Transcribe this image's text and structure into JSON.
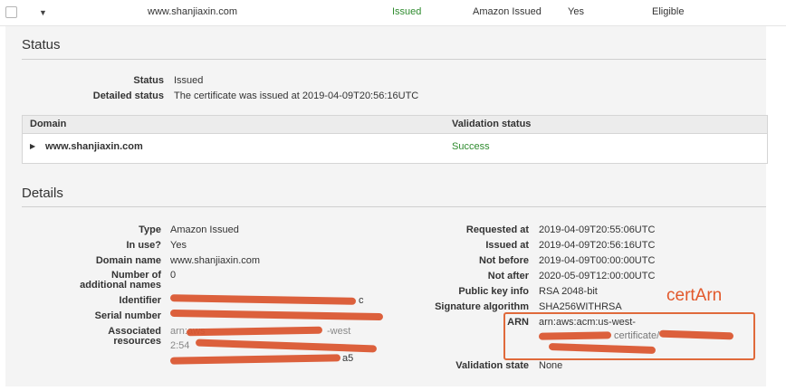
{
  "list_row": {
    "domain": "www.shanjiaxin.com",
    "status": "Issued",
    "type": "Amazon Issued",
    "in_use": "Yes",
    "renewal": "Eligible"
  },
  "status_section": {
    "title": "Status",
    "status_label": "Status",
    "status_value": "Issued",
    "detailed_label": "Detailed status",
    "detailed_value": "The certificate was issued at 2019-04-09T20:56:16UTC"
  },
  "domain_table": {
    "headers": [
      "Domain",
      "Validation status"
    ],
    "rows": [
      {
        "domain": "www.shanjiaxin.com",
        "validation": "Success"
      }
    ]
  },
  "details": {
    "title": "Details",
    "left": {
      "type_label": "Type",
      "type_value": "Amazon Issued",
      "inuse_label": "In use?",
      "inuse_value": "Yes",
      "domain_label": "Domain name",
      "domain_value": "www.shanjiaxin.com",
      "numnames_label_1": "Number of",
      "numnames_label_2": "additional names",
      "numnames_value": "0",
      "identifier_label": "Identifier",
      "serial_label": "Serial number",
      "assoc_label_1": "Associated",
      "assoc_label_2": "resources",
      "assoc_fragment": "arn:aws",
      "assoc_fragment2": "-west",
      "assoc_fragment3": "2:54",
      "assoc_tail": "a5",
      "identifier_tail": "c"
    },
    "right": {
      "requested_label": "Requested at",
      "requested_value": "2019-04-09T20:55:06UTC",
      "issued_label": "Issued at",
      "issued_value": "2019-04-09T20:56:16UTC",
      "notbefore_label": "Not before",
      "notbefore_value": "2019-04-09T00:00:00UTC",
      "notafter_label": "Not after",
      "notafter_value": "2020-05-09T12:00:00UTC",
      "pubkey_label": "Public key info",
      "pubkey_value": "RSA 2048-bit",
      "sigalg_label": "Signature algorithm",
      "sigalg_value": "SHA256WITHRSA",
      "arn_label": "ARN",
      "arn_value_1": "arn:aws:acm:us-west-",
      "arn_value_2": "certificate/",
      "validation_label": "Validation state",
      "validation_value": "None"
    }
  },
  "annotation": {
    "text": "certArn",
    "color": "#e2582b"
  },
  "colors": {
    "success": "#2e8b2e",
    "redaction": "#d9532b"
  }
}
